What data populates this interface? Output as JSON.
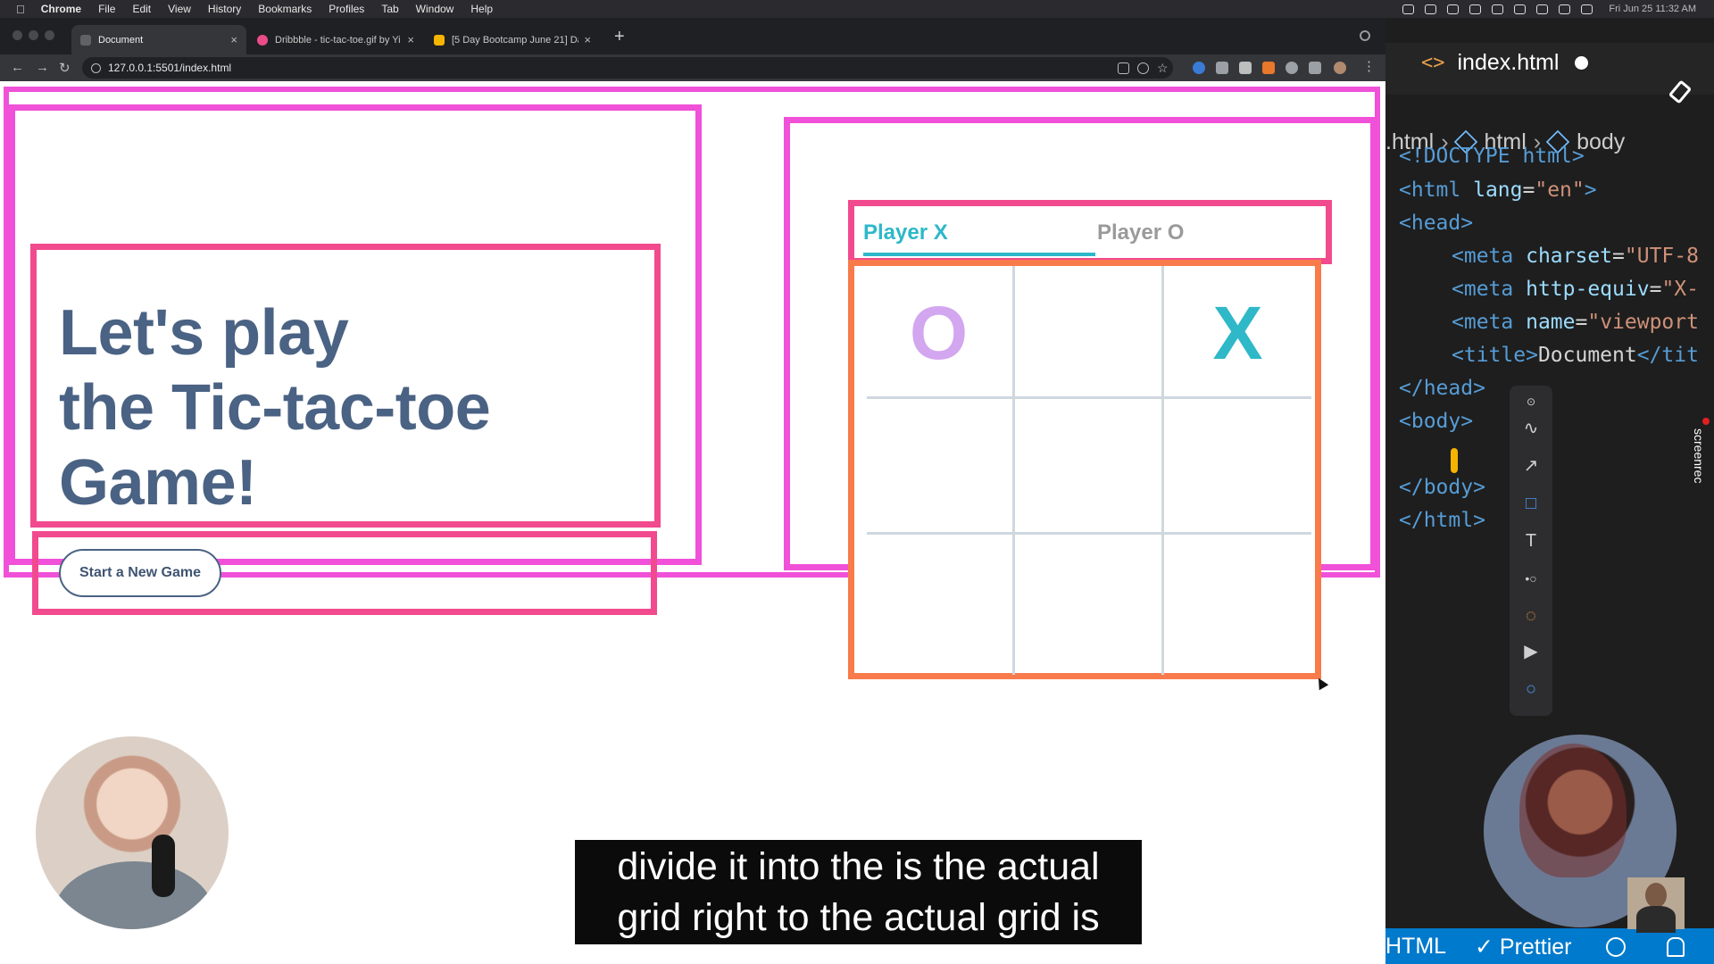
{
  "menubar": {
    "app": "Chrome",
    "items": [
      "File",
      "Edit",
      "View",
      "History",
      "Bookmarks",
      "Profiles",
      "Tab",
      "Window",
      "Help"
    ],
    "clock": "Fri Jun 25  11:32 AM"
  },
  "browser": {
    "tabs": [
      {
        "title": "Document",
        "favicon_color": "#5f6368"
      },
      {
        "title": "Dribbble - tic-tac-toe.gif by Yi",
        "favicon_color": "#ea4c89"
      },
      {
        "title": "[5 Day Bootcamp June 21] Da",
        "favicon_color": "#f4b400"
      }
    ],
    "new_tab": "+",
    "url": "127.0.0.1:5501/index.html"
  },
  "page": {
    "headline": [
      "Let's play",
      "the Tic-tac-toe",
      "Game!"
    ],
    "new_game_button": "Start a New Game",
    "player_tabs": {
      "active": "Player X",
      "inactive": "Player O"
    },
    "board": [
      "O",
      "",
      "X",
      "",
      "",
      "",
      "",
      "",
      ""
    ],
    "colors": {
      "outline_magenta": "#f051d8",
      "outline_pink": "#f24a8e",
      "outline_orange": "#f97a4b",
      "headline": "#4a6283",
      "player_x": "#2db8c9",
      "player_o_mark": "#d3a6f0"
    }
  },
  "caption": [
    "divide it into the is the actual",
    "grid right to the actual grid is"
  ],
  "editor": {
    "tab_title": "index.html",
    "breadcrumb": [
      ".html",
      "html",
      "body"
    ],
    "code_lines": [
      {
        "parts": [
          [
            "tg",
            "<!DOCTYPE html>"
          ]
        ]
      },
      {
        "parts": [
          [
            "tg",
            "<html "
          ],
          [
            "at",
            "lang"
          ],
          [
            "tx",
            "="
          ],
          [
            "st",
            "\"en\""
          ],
          [
            "tg",
            ">"
          ]
        ]
      },
      {
        "parts": [
          [
            "tg",
            "<head>"
          ]
        ]
      },
      {
        "parts": [
          [
            "tg",
            "<meta "
          ],
          [
            "at",
            "charset"
          ],
          [
            "tx",
            "="
          ],
          [
            "st",
            "\"UTF-8"
          ]
        ]
      },
      {
        "parts": [
          [
            "tg",
            "<meta "
          ],
          [
            "at",
            "http-equiv"
          ],
          [
            "tx",
            "="
          ],
          [
            "st",
            "\"X-"
          ]
        ]
      },
      {
        "parts": [
          [
            "tg",
            "<meta "
          ],
          [
            "at",
            "name"
          ],
          [
            "tx",
            "="
          ],
          [
            "st",
            "\"viewport"
          ]
        ]
      },
      {
        "parts": [
          [
            "tg",
            "<title>"
          ],
          [
            "tx",
            "Document"
          ],
          [
            "tg",
            "</tit"
          ]
        ]
      },
      {
        "parts": [
          [
            "tg",
            "</head>"
          ]
        ]
      },
      {
        "parts": [
          [
            "tg",
            "<body>"
          ]
        ]
      },
      {
        "parts": [
          [
            "tx",
            ""
          ]
        ]
      },
      {
        "parts": [
          [
            "tg",
            "</body>"
          ]
        ]
      },
      {
        "parts": [
          [
            "tg",
            "</html>"
          ]
        ]
      }
    ],
    "status": {
      "language": "HTML",
      "formatter": "✓ Prettier"
    }
  },
  "screenrec": {
    "label": "screenrec"
  }
}
